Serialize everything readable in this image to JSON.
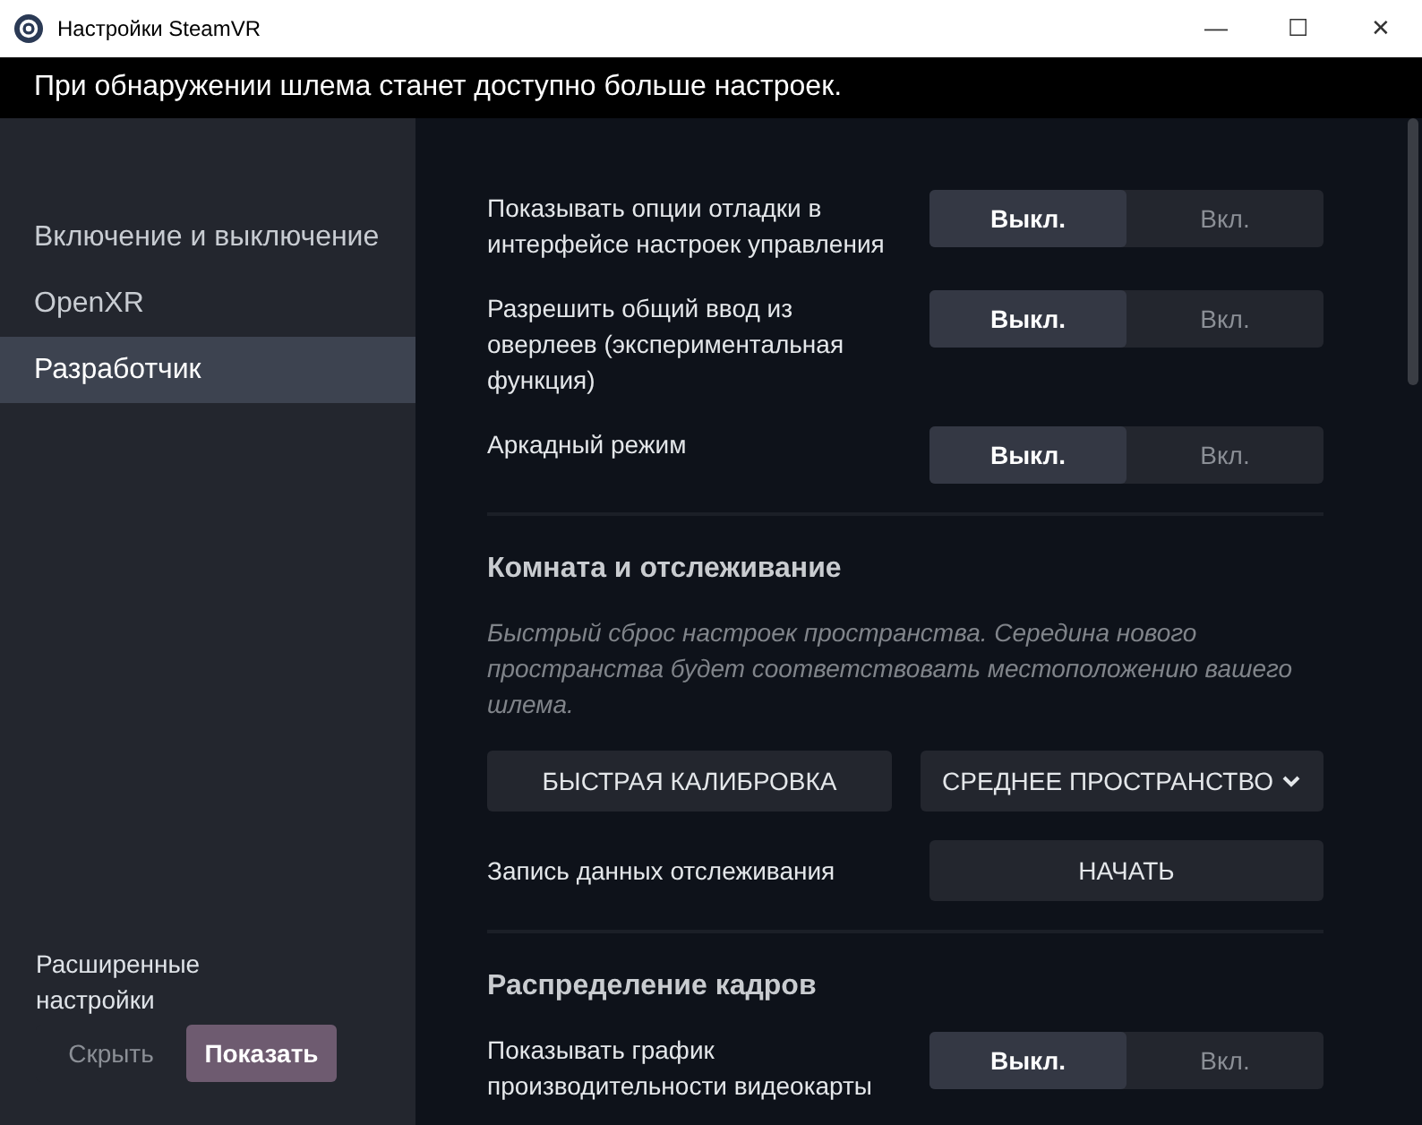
{
  "window": {
    "title": "Настройки SteamVR",
    "controls": [
      "—",
      "☐",
      "✕"
    ]
  },
  "banner": "При обнаружении шлема станет доступно больше настроек.",
  "sidebar": {
    "items": [
      {
        "label": "Включение и выключение",
        "selected": false
      },
      {
        "label": "OpenXR",
        "selected": false
      },
      {
        "label": "Разработчик",
        "selected": true
      }
    ],
    "advanced": {
      "label": "Расширенные настройки",
      "options": [
        {
          "label": "Скрыть",
          "selected": false
        },
        {
          "label": "Показать",
          "selected": true
        }
      ]
    }
  },
  "sections": [
    {
      "rows": [
        {
          "kind": "toggle",
          "label": "Показывать опции отладки в интерфейсе настроек управления",
          "options": [
            {
              "label": "Выкл.",
              "selected": true
            },
            {
              "label": "Вкл.",
              "selected": false
            }
          ]
        },
        {
          "kind": "toggle",
          "label": "Разрешить общий ввод из оверлеев (экспериментальная функция)",
          "options": [
            {
              "label": "Выкл.",
              "selected": true
            },
            {
              "label": "Вкл.",
              "selected": false
            }
          ]
        },
        {
          "kind": "toggle",
          "label": "Аркадный режим",
          "options": [
            {
              "label": "Выкл.",
              "selected": true
            },
            {
              "label": "Вкл.",
              "selected": false
            }
          ]
        }
      ]
    },
    {
      "title": "Комната и отслеживание",
      "rows": [
        {
          "kind": "note",
          "text": "Быстрый сброс настроек пространства. Середина нового пространства будет соответствовать местоположению вашего шлема."
        },
        {
          "kind": "button-pair",
          "button": "БЫСТРАЯ КАЛИБРОВКА",
          "dropdown": "СРЕДНЕЕ ПРОСТРАНСТВО"
        },
        {
          "kind": "action",
          "label": "Запись данных отслеживания",
          "button": "НАЧАТЬ"
        }
      ]
    },
    {
      "title": "Распределение кадров",
      "rows": [
        {
          "kind": "toggle",
          "label": "Показывать график производительности видеокарты",
          "options": [
            {
              "label": "Выкл.",
              "selected": true
            },
            {
              "label": "Вкл.",
              "selected": false
            }
          ]
        }
      ]
    }
  ]
}
